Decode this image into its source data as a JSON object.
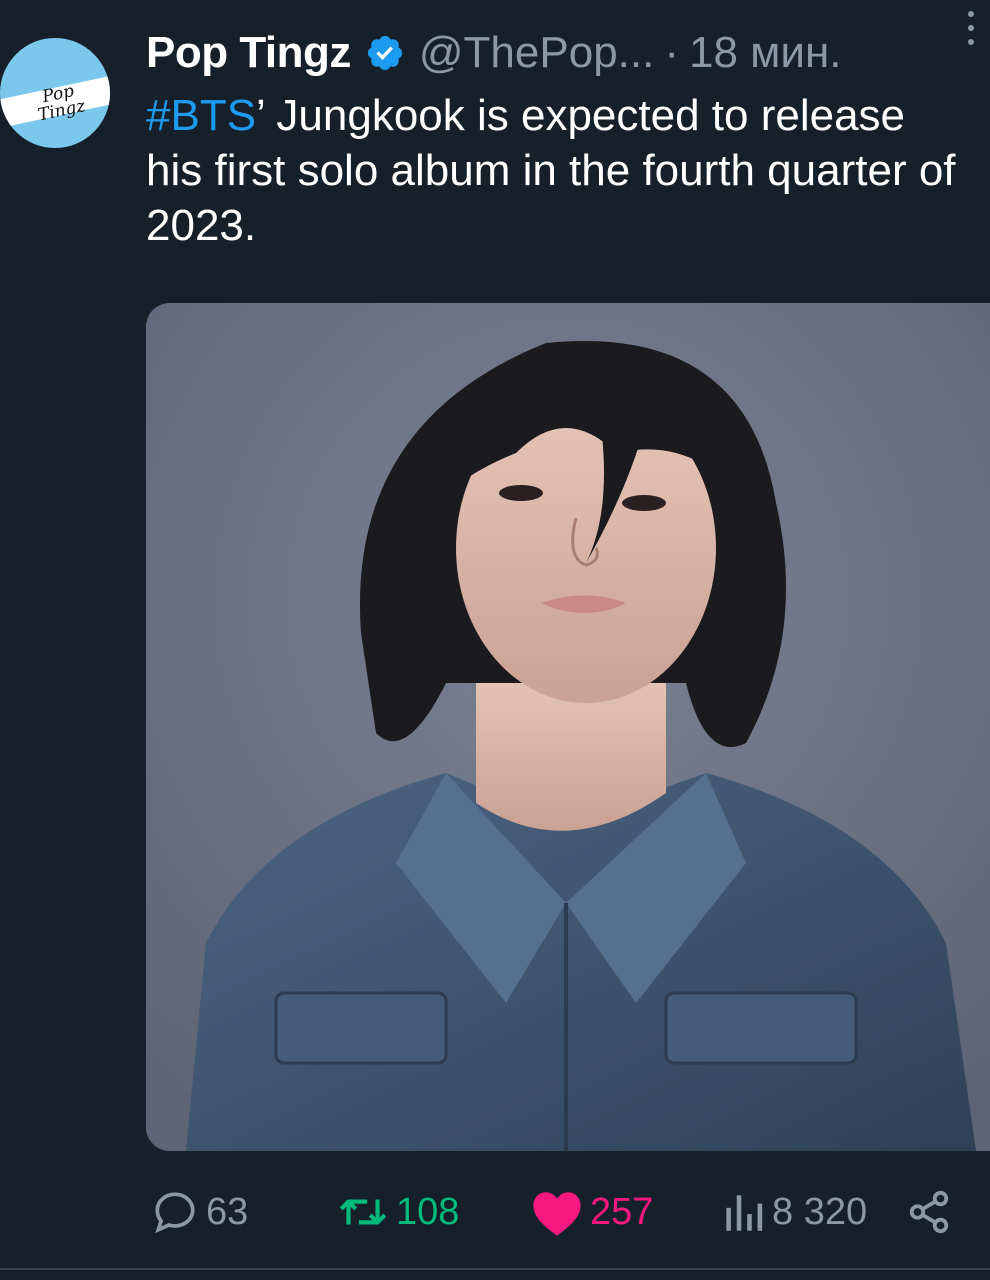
{
  "tweet": {
    "author": {
      "display_name": "Pop Tingz",
      "handle": "@ThePop...",
      "verified": true,
      "avatar_text": "Pop Tingz",
      "avatar_color": "#7cc7ec"
    },
    "separator": "·",
    "time": "18 мин.",
    "text": {
      "hashtag": "#BTS",
      "body": "’ Jungkook is expected to release his first solo album in the fourth quarter of 2023."
    },
    "media": {
      "icon": "photo",
      "background": "#6b7384"
    },
    "stats": {
      "replies": "63",
      "retweets": "108",
      "likes": "257",
      "views": "8 320"
    }
  },
  "colors": {
    "background": "#15202b",
    "text": "#ffffff",
    "muted": "#8b98a5",
    "link": "#1d9bf0",
    "retweet": "#00ba7c",
    "like": "#f91880"
  }
}
